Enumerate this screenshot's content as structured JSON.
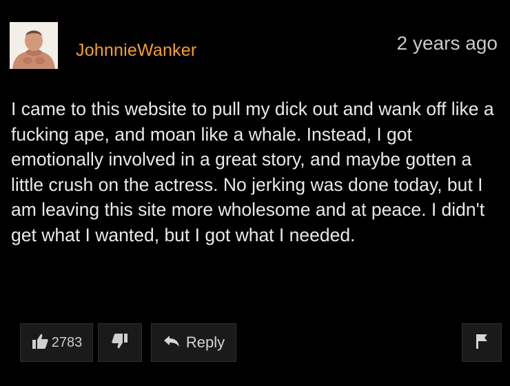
{
  "comment": {
    "author": "JohnnieWanker",
    "timestamp": "2 years ago",
    "text": "I came to this website to pull my dick out and wank off like a fucking ape, and moan like a whale. Instead, I got emotionally involved in a great story, and maybe gotten a little crush on the actress. No jerking was done today, but I am leaving this site more wholesome and at peace. I didn't get what I wanted, but I got what I needed."
  },
  "actions": {
    "like_count": "2783",
    "reply_label": "Reply"
  },
  "icons": {
    "like": "thumbs-up-icon",
    "dislike": "thumbs-down-icon",
    "reply": "reply-arrow-icon",
    "flag": "flag-icon"
  },
  "colors": {
    "background": "#000000",
    "username": "#f4a12a",
    "text": "#e9e9e9",
    "button_bg": "#1a1a1a"
  }
}
